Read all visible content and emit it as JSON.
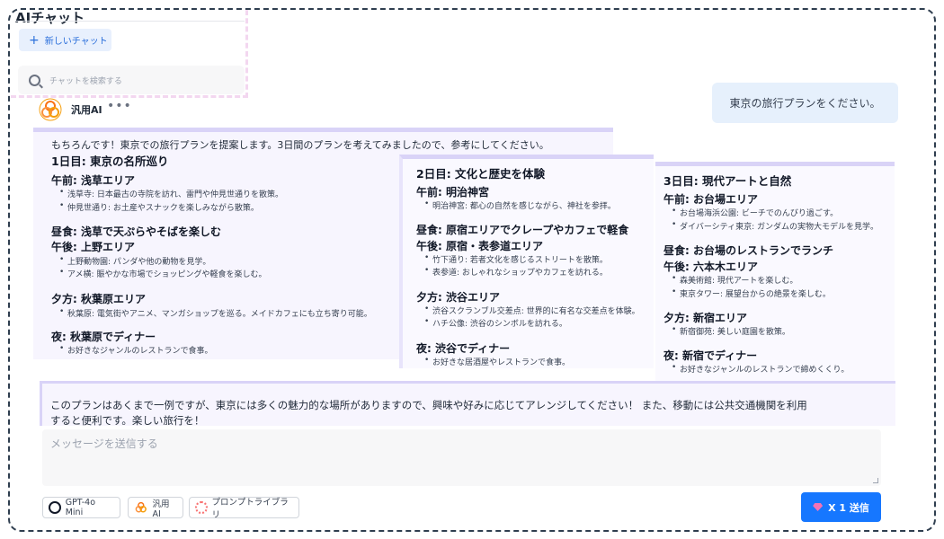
{
  "sidebar": {
    "app_title": "AIチャット",
    "new_chat_label": "新しいチャット",
    "search_placeholder": "チャットを検索する"
  },
  "conversation": {
    "user_message": "東京の旅行プランをください。",
    "bot_name": "汎用AI",
    "more_label": "•••",
    "intro": "もちろんです！東京での旅行プランを提案します。3日間のプランを考えてみましたので、参考にしてください。",
    "days": [
      {
        "title": "1日目: 東京の名所巡り",
        "sections": [
          {
            "heading": "午前: 浅草エリア",
            "items": [
              "浅草寺: 日本最古の寺院を訪れ、雷門や仲見世通りを散策。",
              "仲見世通り: お土産やスナックを楽しみながら散策。"
            ]
          },
          {
            "heading": "昼食: 浅草で天ぷらやそばを楽しむ",
            "items": []
          },
          {
            "heading": "午後: 上野エリア",
            "items": [
              "上野動物園: パンダや他の動物を見学。",
              "アメ横: 賑やかな市場でショッピングや軽食を楽しむ。"
            ]
          },
          {
            "heading": "夕方: 秋葉原エリア",
            "items": [
              "秋葉原: 電気街やアニメ、マンガショップを巡る。メイドカフェにも立ち寄り可能。"
            ]
          },
          {
            "heading": "夜: 秋葉原でディナー",
            "items": [
              "お好きなジャンルのレストランで食事。"
            ]
          }
        ]
      },
      {
        "title": "2日目: 文化と歴史を体験",
        "sections": [
          {
            "heading": "午前: 明治神宮",
            "items": [
              "明治神宮: 都心の自然を感じながら、神社を参拝。"
            ]
          },
          {
            "heading": "昼食: 原宿エリアでクレープやカフェで軽食",
            "items": []
          },
          {
            "heading": "午後: 原宿・表参道エリア",
            "items": [
              "竹下通り: 若者文化を感じるストリートを散策。",
              "表参道: おしゃれなショップやカフェを訪れる。"
            ]
          },
          {
            "heading": "夕方: 渋谷エリア",
            "items": [
              "渋谷スクランブル交差点: 世界的に有名な交差点を体験。",
              "ハチ公像: 渋谷のシンボルを訪れる。"
            ]
          },
          {
            "heading": "夜: 渋谷でディナー",
            "items": [
              "お好きな居酒屋やレストランで食事。"
            ]
          }
        ]
      },
      {
        "title": "3日目: 現代アートと自然",
        "sections": [
          {
            "heading": "午前: お台場エリア",
            "items": [
              "お台場海浜公園: ビーチでのんびり過ごす。",
              "ダイバーシティ東京: ガンダムの実物大モデルを見学。"
            ]
          },
          {
            "heading": "昼食: お台場のレストランでランチ",
            "items": []
          },
          {
            "heading": "午後: 六本木エリア",
            "items": [
              "森美術館: 現代アートを楽しむ。",
              "東京タワー: 展望台からの絶景を楽しむ。"
            ]
          },
          {
            "heading": "夕方: 新宿エリア",
            "items": [
              "新宿御苑: 美しい庭園を散策。"
            ]
          },
          {
            "heading": "夜: 新宿でディナー",
            "items": [
              "お好きなジャンルのレストランで締めくくり。"
            ]
          }
        ]
      }
    ],
    "closing_line_1": "このプランはあくまで一例ですが、東京には多くの魅力的な場所がありますので、興味や好みに応じてアレンジしてください！ また、移動には公共交通機関を利用",
    "closing_line_2": "すると便利です。楽しい旅行を！"
  },
  "composer": {
    "placeholder": "メッセージを送信する",
    "model_chip": "GPT-4o Mini",
    "assistant_chip": "汎用AI",
    "prompt_library_chip": "プロンプトライブラリ",
    "send_label": "X 1 送信"
  },
  "colors": {
    "accent": "#1677ff",
    "panel_bg": "#f7f5fe",
    "panel_border": "#d9d3f7",
    "user_bubble": "#e6f0fc"
  }
}
